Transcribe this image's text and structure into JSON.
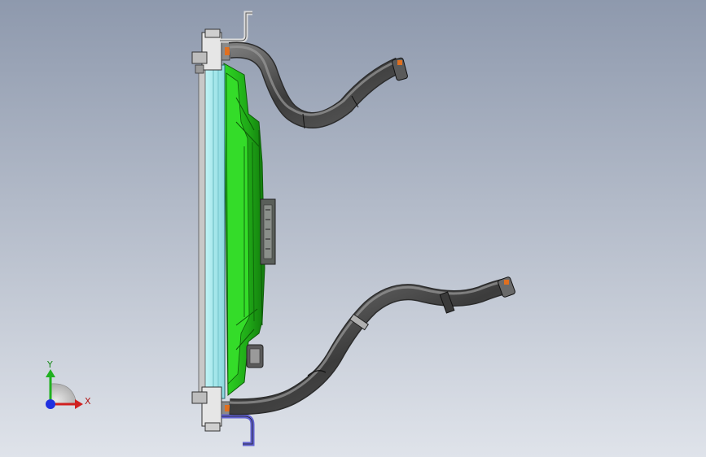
{
  "viewport": {
    "background_top": "#8e99ad",
    "background_bottom": "#dfe3ea"
  },
  "model": {
    "shroud_color": "#22c418",
    "shroud_dark": "#168a0f",
    "core_color": "#a9ecf0",
    "hose_color": "#4a4a4a",
    "hose_highlight": "#8c8c8c",
    "tank_color": "#d8d8d8",
    "orange_accent": "#e07020",
    "blue_accent": "#6060d0"
  },
  "triad": {
    "x_label": "X",
    "y_label": "Y",
    "x_color": "#d02020",
    "y_color": "#20b020",
    "origin_color": "#2030e0"
  }
}
